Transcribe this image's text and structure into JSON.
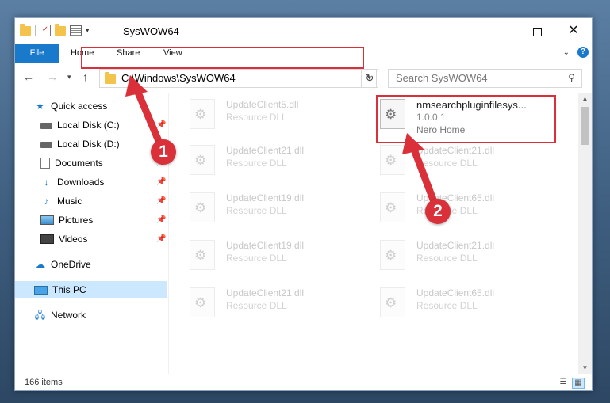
{
  "window": {
    "title": "SysWOW64"
  },
  "window_controls": {
    "minimize": "—",
    "maximize": "",
    "close": "✕"
  },
  "ribbon": {
    "tabs": [
      "File",
      "Home",
      "Share",
      "View"
    ],
    "help": "?"
  },
  "nav": {
    "address": "C:\\Windows\\SysWOW64",
    "search_placeholder": "Search SysWOW64"
  },
  "sidebar": {
    "items": [
      {
        "label": "Quick access",
        "icon": "star-icon"
      },
      {
        "label": "Local Disk (C:)",
        "icon": "disk-icon"
      },
      {
        "label": "Local Disk (D:)",
        "icon": "disk-icon"
      },
      {
        "label": "Documents",
        "icon": "documents-icon"
      },
      {
        "label": "Downloads",
        "icon": "download-icon"
      },
      {
        "label": "Music",
        "icon": "music-icon"
      },
      {
        "label": "Pictures",
        "icon": "pictures-icon"
      },
      {
        "label": "Videos",
        "icon": "videos-icon"
      },
      {
        "label": "OneDrive",
        "icon": "cloud-icon"
      },
      {
        "label": "This PC",
        "icon": "computer-icon"
      },
      {
        "label": "Network",
        "icon": "network-icon"
      }
    ]
  },
  "files": [
    {
      "name": "UpdateClient5.dll",
      "desc": "Resource DLL"
    },
    {
      "name": "UpdateClient21.dll",
      "desc": "Resource DLL"
    },
    {
      "name": "UpdateClient19.dll",
      "desc": "Resource DLL"
    },
    {
      "name": "UpdateClient19.dll",
      "desc": "Resource DLL"
    },
    {
      "name": "UpdateClient21.dll",
      "desc": "Resource DLL"
    },
    {
      "name": "UpdateClient21.dll",
      "desc": "Resource DLL"
    },
    {
      "name": "UpdateClient65.dll",
      "desc": "Resource DLL"
    },
    {
      "name": "UpdateClient21.dll",
      "desc": "Resource DLL"
    },
    {
      "name": "UpdateClient65.dll",
      "desc": "Resource DLL"
    }
  ],
  "highlighted_file": {
    "name": "nmsearchpluginfilesys...",
    "version": "1.0.0.1",
    "company": "Nero Home"
  },
  "status": {
    "item_count": "166 items"
  },
  "annotations": {
    "step1": "1",
    "step2": "2",
    "color": "#d9303a"
  }
}
